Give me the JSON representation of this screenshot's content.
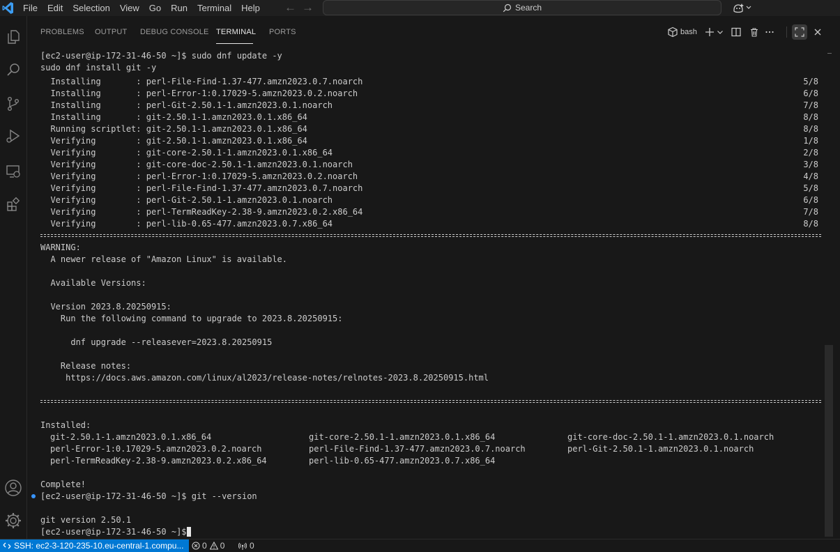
{
  "menu": [
    "File",
    "Edit",
    "Selection",
    "View",
    "Go",
    "Run",
    "Terminal",
    "Help"
  ],
  "search": {
    "label": "Search"
  },
  "panel": {
    "tabs": [
      "PROBLEMS",
      "OUTPUT",
      "DEBUG CONSOLE",
      "TERMINAL",
      "PORTS"
    ],
    "active_tab": "TERMINAL",
    "shell_label": "bash"
  },
  "terminal": {
    "lines": [
      "[ec2-user@ip-172-31-46-50 ~]$ sudo dnf update -y",
      "sudo dnf install git -y"
    ],
    "transaction": [
      {
        "text": "  Installing       : perl-File-Find-1.37-477.amzn2023.0.7.noarch",
        "count": "5/8"
      },
      {
        "text": "  Installing       : perl-Error-1:0.17029-5.amzn2023.0.2.noarch",
        "count": "6/8"
      },
      {
        "text": "  Installing       : perl-Git-2.50.1-1.amzn2023.0.1.noarch",
        "count": "7/8"
      },
      {
        "text": "  Installing       : git-2.50.1-1.amzn2023.0.1.x86_64",
        "count": "8/8"
      },
      {
        "text": "  Running scriptlet: git-2.50.1-1.amzn2023.0.1.x86_64",
        "count": "8/8"
      },
      {
        "text": "  Verifying        : git-2.50.1-1.amzn2023.0.1.x86_64",
        "count": "1/8"
      },
      {
        "text": "  Verifying        : git-core-2.50.1-1.amzn2023.0.1.x86_64",
        "count": "2/8"
      },
      {
        "text": "  Verifying        : git-core-doc-2.50.1-1.amzn2023.0.1.noarch",
        "count": "3/8"
      },
      {
        "text": "  Verifying        : perl-Error-1:0.17029-5.amzn2023.0.2.noarch",
        "count": "4/8"
      },
      {
        "text": "  Verifying        : perl-File-Find-1.37-477.amzn2023.0.7.noarch",
        "count": "5/8"
      },
      {
        "text": "  Verifying        : perl-Git-2.50.1-1.amzn2023.0.1.noarch",
        "count": "6/8"
      },
      {
        "text": "  Verifying        : perl-TermReadKey-2.38-9.amzn2023.0.2.x86_64",
        "count": "7/8"
      },
      {
        "text": "  Verifying        : perl-lib-0.65-477.amzn2023.0.7.x86_64",
        "count": "8/8"
      }
    ],
    "warning": [
      "WARNING:",
      "  A newer release of \"Amazon Linux\" is available.",
      "",
      "  Available Versions:",
      "",
      "  Version 2023.8.20250915:",
      "    Run the following command to upgrade to 2023.8.20250915:",
      "",
      "      dnf upgrade --releasever=2023.8.20250915",
      "",
      "    Release notes:",
      "     https://docs.aws.amazon.com/linux/al2023/release-notes/relnotes-2023.8.20250915.html"
    ],
    "installed_label": "Installed:",
    "installed": [
      [
        "git-2.50.1-1.amzn2023.0.1.x86_64",
        "git-core-2.50.1-1.amzn2023.0.1.x86_64",
        "git-core-doc-2.50.1-1.amzn2023.0.1.noarch"
      ],
      [
        "perl-Error-1:0.17029-5.amzn2023.0.2.noarch",
        "perl-File-Find-1.37-477.amzn2023.0.7.noarch",
        "perl-Git-2.50.1-1.amzn2023.0.1.noarch"
      ],
      [
        "perl-TermReadKey-2.38-9.amzn2023.0.2.x86_64",
        "perl-lib-0.65-477.amzn2023.0.7.x86_64",
        ""
      ]
    ],
    "complete": "Complete!",
    "prompt_git": "[ec2-user@ip-172-31-46-50 ~]$ git --version",
    "git_version": "git version 2.50.1",
    "prompt_final": "[ec2-user@ip-172-31-46-50 ~]$ "
  },
  "status": {
    "ssh": "SSH: ec2-3-120-235-10.eu-central-1.compu...",
    "errors": "0",
    "warnings": "0",
    "ports": "0"
  },
  "colors": {
    "accent": "#0078d4",
    "background": "#181818",
    "terminal_text": "#cccccc",
    "dot": "#3794ff"
  }
}
